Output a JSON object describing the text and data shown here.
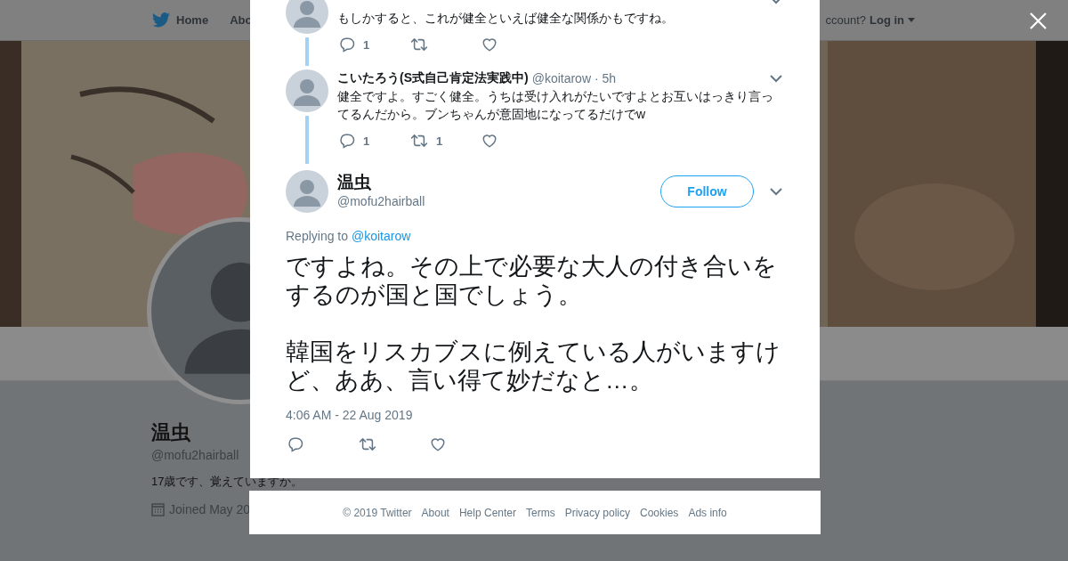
{
  "header": {
    "nav": [
      {
        "label": "Home"
      },
      {
        "label": "Abo"
      }
    ],
    "account_prompt": "ccount?",
    "login": "Log in"
  },
  "profile": {
    "name": "温虫",
    "handle": "@mofu2hairball",
    "bio": "17歳です、覚えていますか。",
    "joined": "Joined May 20"
  },
  "thread": [
    {
      "text": "もしかすると、これが健全といえば健全な関係かもですね。",
      "replies": "1"
    },
    {
      "name": "こいたろう(S式自己肯定法実践中)",
      "handle": "@koitarow",
      "time": "· 5h",
      "text": "健全ですよ。すごく健全。うちは受け入れがたいですよとお互いはっきり言ってるんだから。ブンちゃんが意固地になってるだけでw",
      "replies": "1",
      "retweets": "1"
    }
  ],
  "main_tweet": {
    "name": "温虫",
    "handle": "@mofu2hairball",
    "follow": "Follow",
    "replying_prefix": "Replying to",
    "reply_to": "@koitarow",
    "paragraphs": [
      "ですよね。その上で必要な大人の付き合いをするのが国と国でしょう。",
      "韓国をリスカブスに例えている人がいますけど、ああ、言い得て妙だなと…。"
    ],
    "timestamp": "4:06 AM - 22 Aug 2019"
  },
  "footer": {
    "copyright": "© 2019 Twitter",
    "links": [
      "About",
      "Help Center",
      "Terms",
      "Privacy policy",
      "Cookies",
      "Ads info"
    ]
  }
}
